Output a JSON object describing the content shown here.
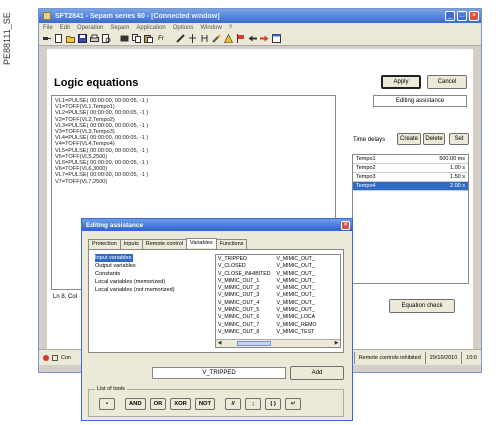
{
  "figure_code": "PE88111_SE",
  "window": {
    "title": "SFT2841 - Sepam series 60 - [Connected window]"
  },
  "menu": [
    "File",
    "Edit",
    "Operation",
    "Sepam",
    "Application",
    "Options",
    "Window",
    "?"
  ],
  "toolbar_icons": [
    "plug-icon",
    "new-icon",
    "open-icon",
    "save-icon",
    "print-icon",
    "print-preview-icon",
    "cut-icon",
    "copy-icon",
    "paste-icon",
    "fr-icon",
    "pen-icon",
    "tree-icon",
    "fork-icon",
    "wrench-icon",
    "warning-icon",
    "flag-icon",
    "arrow-left-icon",
    "arrow-right-icon",
    "window-icon"
  ],
  "main": {
    "heading": "Logic equations",
    "equations": [
      "VL1=PULSE( 00:00:00, 00:00:05, -1 )",
      "V1=TOFF(VL1,Tempo1)",
      "VL2=PULSE( 00:00:00, 00:00:05, -1 )",
      "V2=TOFF(VL2,Tempo2)",
      "VL3=PULSE( 00:00:00, 00:00:05, -1 )",
      "V3=TOFF(VL3,Tempo3)",
      "VL4=PULSE( 00:00:00, 00:00:05, -1 )",
      "V4=TOFF(VL4,Tempo4)",
      "VL5=PULSE( 00:00:00, 00:00:05, -1 )",
      "V5=TOFF(VL5,2500)",
      "VL6=PULSE( 00:00:00, 00:00:05, -1 )",
      "V6=TOFF(VL6,3000)",
      "VL7=PULSE( 00:00:00, 00:00:05, -1 )",
      "V7=TOFF(VL7,2500)"
    ],
    "apply_label": "Apply",
    "cancel_label": "Cancel",
    "editing_assistance_label": "Editing assistance",
    "time_delays_label": "Time delays",
    "create_label": "Create",
    "delete_label": "Delete",
    "set_label": "Set",
    "delays": [
      {
        "name": "Tempo1",
        "value": "500.00 ms"
      },
      {
        "name": "Tempo2",
        "value": "1.00 s"
      },
      {
        "name": "Tempo3",
        "value": "1.50 s"
      },
      {
        "name": "Tempo4",
        "value": "2.00 s"
      }
    ],
    "selected_delay": 3,
    "cursor_pos": "Ln 8, Col",
    "equation_check_label": "Equation check"
  },
  "status": {
    "left": "Con",
    "remote": "Remote controls inhibited",
    "date": "29/10/2010",
    "time": "10:0"
  },
  "dialog": {
    "title": "Editing assistance",
    "tabs": [
      "Protection",
      "Inputs",
      "Remote control",
      "Variables",
      "Functions"
    ],
    "active_tab": 3,
    "categories": [
      "Input variables",
      "Output variables",
      "Constants",
      "Local variables (memorized)",
      "Local variables (not memorized)"
    ],
    "variables_col1": [
      "V_TRIPPED",
      "V_CLOSED",
      "V_CLOSE_INHIBITED",
      "V_MIMIC_OUT_1",
      "V_MIMIC_OUT_2",
      "V_MIMIC_OUT_3",
      "V_MIMIC_OUT_4",
      "V_MIMIC_OUT_5",
      "V_MIMIC_OUT_6",
      "V_MIMIC_OUT_7",
      "V_MIMIC_OUT_8"
    ],
    "variables_col2": [
      "V_MIMIC_OUT_",
      "V_MIMIC_OUT_",
      "V_MIMIC_OUT_",
      "V_MIMIC_OUT_",
      "V_MIMIC_OUT_",
      "V_MIMIC_OUT_",
      "V_MIMIC_OUT_",
      "V_MIMIC_OUT_",
      "V_MIMIC_LOCA",
      "V_MIMIC_REMO",
      "V_MIMIC_TEST"
    ],
    "selected_variable": "V_TRIPPED",
    "add_label": "Add",
    "list_of_tools_label": "List of tools",
    "tools": [
      "•",
      "AND",
      "OR",
      "XOR",
      "NOT",
      "//",
      ";",
      "( )",
      "↵"
    ]
  }
}
